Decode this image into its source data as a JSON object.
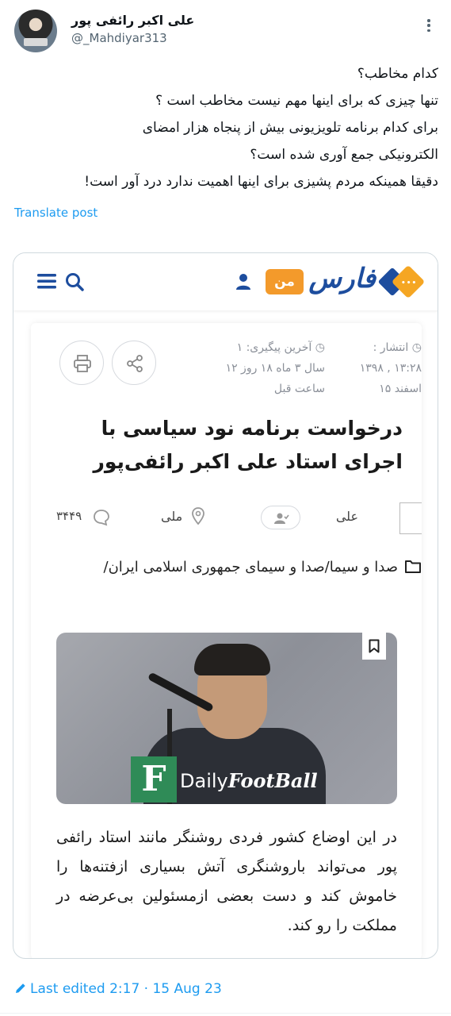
{
  "author": {
    "display_name": "علی اکبر رائفی پور",
    "handle": "@_Mahdiyar313"
  },
  "tweet": {
    "lines": [
      "کدام مخاطب؟",
      "تنها چیزی که برای اینها مهم نیست مخاطب است ؟",
      "برای کدام برنامه تلویزیونی بیش از پنجاه هزار امضای",
      "الکترونیکی جمع آوری شده است؟",
      "دقیقا همینکه مردم پشیزی برای اینها اهمیت ندارد درد آور است!"
    ],
    "translate_label": "Translate post",
    "edited_label": "Last edited 2:17 · 15 Aug 23"
  },
  "card": {
    "site_logo_text": "فارس",
    "badge_label": "من",
    "publish_label": "انتشار :",
    "publish_value": "۱۳:۲۸ , ۱۳۹۸",
    "publish_value2": "اسفند ۱۵",
    "update_label": "آخرین پیگیری: ۱",
    "update_value": "سال ۳ ماه ۱۸ روز ۱۲",
    "update_value2": "ساعت قبل",
    "headline": "درخواست برنامه نود سیاسی با اجرای استاد علی اکبر رائفی‌پور",
    "author_name": "علی",
    "location": "ملی",
    "comment_count": "۳۴۴۹",
    "category": "صدا و سیما/صدا و سیمای جمهوری اسلامی ایران/",
    "image_watermark": "Daily",
    "image_watermark_bold": "FootBall",
    "image_watermark_letter": "F",
    "lead": "در این اوضاع کشور فردی روشنگر مانند استاد رائفی پور می‌تواند باروشنگری آتش بسیاری ازفتنه‌ها را خاموش کند و دست بعضی ازمسئولین بی‌عرضه در مملکت را رو کند."
  },
  "icons": {
    "more": "more-icon",
    "menu": "menu-icon",
    "search": "search-icon",
    "user": "user-icon",
    "share": "share-icon",
    "print": "print-icon",
    "follow": "follow-user-icon",
    "location": "location-pin-icon",
    "comment": "comment-icon",
    "folder": "folder-icon",
    "bookmark": "bookmark-icon",
    "pencil": "pencil-icon"
  },
  "colors": {
    "link_blue": "#1d9bf0",
    "fars_blue": "#1d4d9e",
    "fars_orange": "#f39a2b"
  }
}
